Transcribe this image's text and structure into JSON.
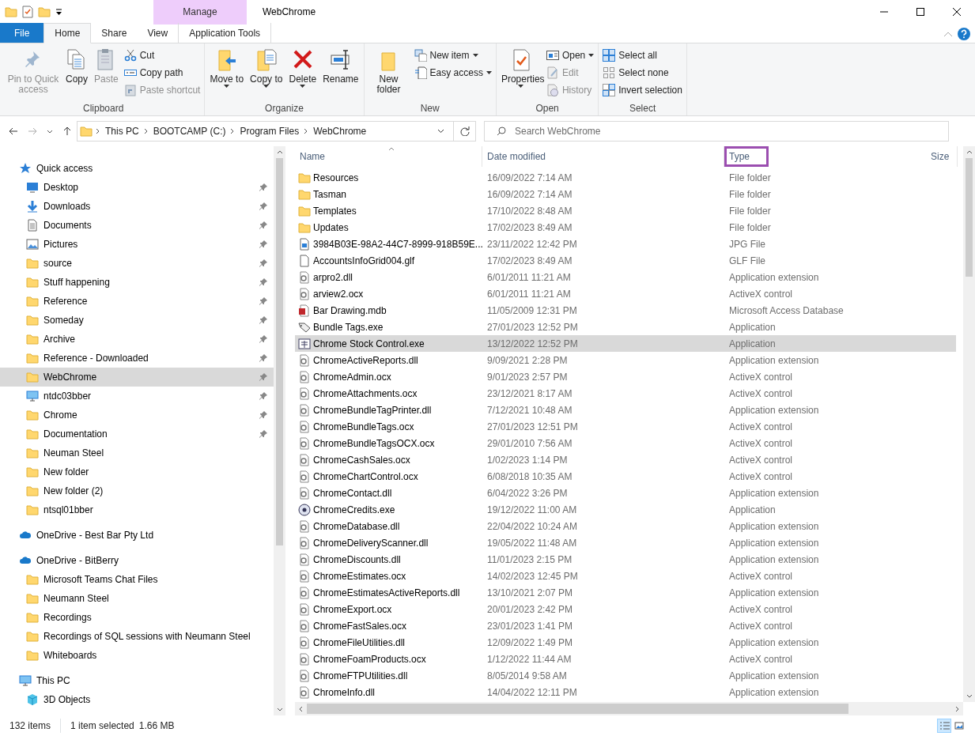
{
  "window": {
    "title": "WebChrome",
    "context_tab": {
      "group": "Manage",
      "label": "Application Tools"
    }
  },
  "tabs": [
    {
      "label": "File",
      "kind": "file",
      "selected": false
    },
    {
      "label": "Home",
      "kind": "tab",
      "selected": true
    },
    {
      "label": "Share",
      "kind": "tab",
      "selected": false
    },
    {
      "label": "View",
      "kind": "tab",
      "selected": false
    }
  ],
  "ribbon": [
    {
      "label": "Clipboard",
      "items": [
        {
          "label": "Pin to Quick access",
          "kind": "large",
          "disabled": true,
          "dropdown": false
        },
        {
          "label": "Copy",
          "kind": "large",
          "disabled": false,
          "dropdown": false
        },
        {
          "label": "Paste",
          "kind": "large",
          "disabled": true,
          "dropdown": false
        },
        {
          "label": "Cut",
          "kind": "small",
          "disabled": false,
          "dropdown": false
        },
        {
          "label": "Copy path",
          "kind": "small",
          "disabled": false,
          "dropdown": false
        },
        {
          "label": "Paste shortcut",
          "kind": "small",
          "disabled": true,
          "dropdown": false
        }
      ]
    },
    {
      "label": "Organize",
      "items": [
        {
          "label": "Move to",
          "kind": "large",
          "disabled": false,
          "dropdown": true
        },
        {
          "label": "Copy to",
          "kind": "large",
          "disabled": false,
          "dropdown": true
        },
        {
          "label": "Delete",
          "kind": "large",
          "disabled": false,
          "dropdown": true
        },
        {
          "label": "Rename",
          "kind": "large",
          "disabled": false,
          "dropdown": false
        }
      ]
    },
    {
      "label": "New",
      "items": [
        {
          "label": "New folder",
          "kind": "large",
          "disabled": false,
          "dropdown": false
        },
        {
          "label": "New item",
          "kind": "small",
          "disabled": false,
          "dropdown": true
        },
        {
          "label": "Easy access",
          "kind": "small",
          "disabled": false,
          "dropdown": true
        }
      ]
    },
    {
      "label": "Open",
      "items": [
        {
          "label": "Properties",
          "kind": "large",
          "disabled": false,
          "dropdown": true
        },
        {
          "label": "Open",
          "kind": "small",
          "disabled": false,
          "dropdown": true
        },
        {
          "label": "Edit",
          "kind": "small",
          "disabled": true,
          "dropdown": false
        },
        {
          "label": "History",
          "kind": "small",
          "disabled": true,
          "dropdown": false
        }
      ]
    },
    {
      "label": "Select",
      "items": [
        {
          "label": "Select all",
          "kind": "small",
          "disabled": false,
          "dropdown": false
        },
        {
          "label": "Select none",
          "kind": "small",
          "disabled": false,
          "dropdown": false
        },
        {
          "label": "Invert selection",
          "kind": "small",
          "disabled": false,
          "dropdown": false
        }
      ]
    }
  ],
  "address": {
    "path": [
      "This PC",
      "BOOTCAMP (C:)",
      "Program Files",
      "WebChrome"
    ]
  },
  "search": {
    "placeholder": "Search WebChrome"
  },
  "sidebar": {
    "items": [
      {
        "label": "Quick access",
        "kind": "star",
        "selected": false,
        "children": [
          {
            "label": "Desktop",
            "kind": "desktop",
            "pinned": true,
            "selected": false
          },
          {
            "label": "Downloads",
            "kind": "downloads",
            "pinned": true,
            "selected": false
          },
          {
            "label": "Documents",
            "kind": "documents",
            "pinned": true,
            "selected": false
          },
          {
            "label": "Pictures",
            "kind": "pictures",
            "pinned": true,
            "selected": false
          },
          {
            "label": "source",
            "kind": "folder",
            "pinned": true,
            "selected": false
          },
          {
            "label": "Stuff happening",
            "kind": "folder",
            "pinned": true,
            "selected": false
          },
          {
            "label": "Reference",
            "kind": "folder",
            "pinned": true,
            "selected": false
          },
          {
            "label": "Someday",
            "kind": "folder",
            "pinned": true,
            "selected": false
          },
          {
            "label": "Archive",
            "kind": "folder",
            "pinned": true,
            "selected": false
          },
          {
            "label": "Reference - Downloaded",
            "kind": "folder",
            "pinned": true,
            "selected": false
          },
          {
            "label": "WebChrome",
            "kind": "folder",
            "pinned": true,
            "selected": true
          },
          {
            "label": "ntdc03bber",
            "kind": "computer",
            "pinned": true,
            "selected": false
          },
          {
            "label": "Chrome",
            "kind": "folder",
            "pinned": true,
            "selected": false
          },
          {
            "label": "Documentation",
            "kind": "folder",
            "pinned": true,
            "selected": false
          },
          {
            "label": "Neuman Steel",
            "kind": "folder",
            "pinned": false,
            "selected": false
          },
          {
            "label": "New folder",
            "kind": "folder",
            "pinned": false,
            "selected": false
          },
          {
            "label": "New folder (2)",
            "kind": "folder",
            "pinned": false,
            "selected": false
          },
          {
            "label": "ntsql01bber",
            "kind": "folder",
            "pinned": false,
            "selected": false
          }
        ]
      },
      {
        "label": "OneDrive - Best Bar Pty Ltd",
        "kind": "cloud",
        "selected": false
      },
      {
        "label": "OneDrive - BitBerry",
        "kind": "cloud",
        "selected": false,
        "children": [
          {
            "label": "Microsoft Teams Chat Files",
            "kind": "folder",
            "pinned": false,
            "selected": false
          },
          {
            "label": "Neumann Steel",
            "kind": "folder",
            "pinned": false,
            "selected": false
          },
          {
            "label": "Recordings",
            "kind": "folder",
            "pinned": false,
            "selected": false
          },
          {
            "label": "Recordings of SQL sessions with Neumann Steel",
            "kind": "folder",
            "pinned": false,
            "selected": false
          },
          {
            "label": "Whiteboards",
            "kind": "folder",
            "pinned": false,
            "selected": false
          }
        ]
      },
      {
        "label": "This PC",
        "kind": "computer",
        "selected": false,
        "children": [
          {
            "label": "3D Objects",
            "kind": "cube",
            "pinned": false,
            "selected": false
          }
        ]
      }
    ]
  },
  "table": {
    "columns": [
      {
        "label": "Name",
        "highlighted": false,
        "sorted": true
      },
      {
        "label": "Date modified",
        "highlighted": false,
        "sorted": false
      },
      {
        "label": "Type",
        "highlighted": true,
        "sorted": false
      },
      {
        "label": "Size",
        "highlighted": false,
        "sorted": false
      }
    ],
    "rows": [
      {
        "name": "Resources",
        "date": "16/09/2022 7:14 AM",
        "type": "File folder",
        "kind": "folder",
        "selected": false
      },
      {
        "name": "Tasman",
        "date": "16/09/2022 7:14 AM",
        "type": "File folder",
        "kind": "folder",
        "selected": false
      },
      {
        "name": "Templates",
        "date": "17/10/2022 8:48 AM",
        "type": "File folder",
        "kind": "folder",
        "selected": false
      },
      {
        "name": "Updates",
        "date": "17/02/2023 8:49 AM",
        "type": "File folder",
        "kind": "folder",
        "selected": false
      },
      {
        "name": "3984B03E-98A2-44C7-8999-918B59E...",
        "date": "23/11/2022 12:42 PM",
        "type": "JPG File",
        "kind": "image",
        "selected": false
      },
      {
        "name": "AccountsInfoGrid004.glf",
        "date": "17/02/2023 8:49 AM",
        "type": "GLF File",
        "kind": "file",
        "selected": false
      },
      {
        "name": "arpro2.dll",
        "date": "6/01/2011 11:21 AM",
        "type": "Application extension",
        "kind": "extension",
        "selected": false
      },
      {
        "name": "arview2.ocx",
        "date": "6/01/2011 11:21 AM",
        "type": "ActiveX control",
        "kind": "extension",
        "selected": false
      },
      {
        "name": "Bar Drawing.mdb",
        "date": "11/05/2009 12:31 PM",
        "type": "Microsoft Access Database",
        "kind": "database",
        "selected": false
      },
      {
        "name": "Bundle Tags.exe",
        "date": "27/01/2023 12:52 PM",
        "type": "Application",
        "kind": "tag",
        "selected": false
      },
      {
        "name": "Chrome Stock Control.exe",
        "date": "13/12/2022 12:52 PM",
        "type": "Application",
        "kind": "application",
        "selected": true
      },
      {
        "name": "ChromeActiveReports.dll",
        "date": "9/09/2021 2:28 PM",
        "type": "Application extension",
        "kind": "extension",
        "selected": false
      },
      {
        "name": "ChromeAdmin.ocx",
        "date": "9/01/2023 2:57 PM",
        "type": "ActiveX control",
        "kind": "extension",
        "selected": false
      },
      {
        "name": "ChromeAttachments.ocx",
        "date": "23/12/2021 8:17 AM",
        "type": "ActiveX control",
        "kind": "extension",
        "selected": false
      },
      {
        "name": "ChromeBundleTagPrinter.dll",
        "date": "7/12/2021 10:48 AM",
        "type": "Application extension",
        "kind": "extension",
        "selected": false
      },
      {
        "name": "ChromeBundleTags.ocx",
        "date": "27/01/2023 12:51 PM",
        "type": "ActiveX control",
        "kind": "extension",
        "selected": false
      },
      {
        "name": "ChromeBundleTagsOCX.ocx",
        "date": "29/01/2010 7:56 AM",
        "type": "ActiveX control",
        "kind": "extension",
        "selected": false
      },
      {
        "name": "ChromeCashSales.ocx",
        "date": "1/02/2023 1:14 PM",
        "type": "ActiveX control",
        "kind": "extension",
        "selected": false
      },
      {
        "name": "ChromeChartControl.ocx",
        "date": "6/08/2018 10:35 AM",
        "type": "ActiveX control",
        "kind": "extension",
        "selected": false
      },
      {
        "name": "ChromeContact.dll",
        "date": "6/04/2022 3:26 PM",
        "type": "Application extension",
        "kind": "extension",
        "selected": false
      },
      {
        "name": "ChromeCredits.exe",
        "date": "19/12/2022 11:00 AM",
        "type": "Application",
        "kind": "disc",
        "selected": false
      },
      {
        "name": "ChromeDatabase.dll",
        "date": "22/04/2022 10:24 AM",
        "type": "Application extension",
        "kind": "extension",
        "selected": false
      },
      {
        "name": "ChromeDeliveryScanner.dll",
        "date": "19/05/2022 11:48 AM",
        "type": "Application extension",
        "kind": "extension",
        "selected": false
      },
      {
        "name": "ChromeDiscounts.dll",
        "date": "11/01/2023 2:15 PM",
        "type": "Application extension",
        "kind": "extension",
        "selected": false
      },
      {
        "name": "ChromeEstimates.ocx",
        "date": "14/02/2023 12:45 PM",
        "type": "ActiveX control",
        "kind": "extension",
        "selected": false
      },
      {
        "name": "ChromeEstimatesActiveReports.dll",
        "date": "13/10/2021 2:07 PM",
        "type": "Application extension",
        "kind": "extension",
        "selected": false
      },
      {
        "name": "ChromeExport.ocx",
        "date": "20/01/2023 2:42 PM",
        "type": "ActiveX control",
        "kind": "extension",
        "selected": false
      },
      {
        "name": "ChromeFastSales.ocx",
        "date": "23/01/2023 1:41 PM",
        "type": "ActiveX control",
        "kind": "extension",
        "selected": false
      },
      {
        "name": "ChromeFileUtilities.dll",
        "date": "12/09/2022 1:49 PM",
        "type": "Application extension",
        "kind": "extension",
        "selected": false
      },
      {
        "name": "ChromeFoamProducts.ocx",
        "date": "1/12/2022 11:44 AM",
        "type": "ActiveX control",
        "kind": "extension",
        "selected": false
      },
      {
        "name": "ChromeFTPUtilities.dll",
        "date": "8/05/2014 9:58 AM",
        "type": "Application extension",
        "kind": "extension",
        "selected": false
      },
      {
        "name": "ChromeInfo.dll",
        "date": "14/04/2022 12:11 PM",
        "type": "Application extension",
        "kind": "extension",
        "selected": false
      }
    ]
  },
  "status_bar": {
    "count": "132 items",
    "selection": "1 item selected",
    "size": "1.66 MB",
    "views": [
      {
        "kind": "details",
        "selected": true
      },
      {
        "kind": "icons",
        "selected": false
      }
    ]
  }
}
